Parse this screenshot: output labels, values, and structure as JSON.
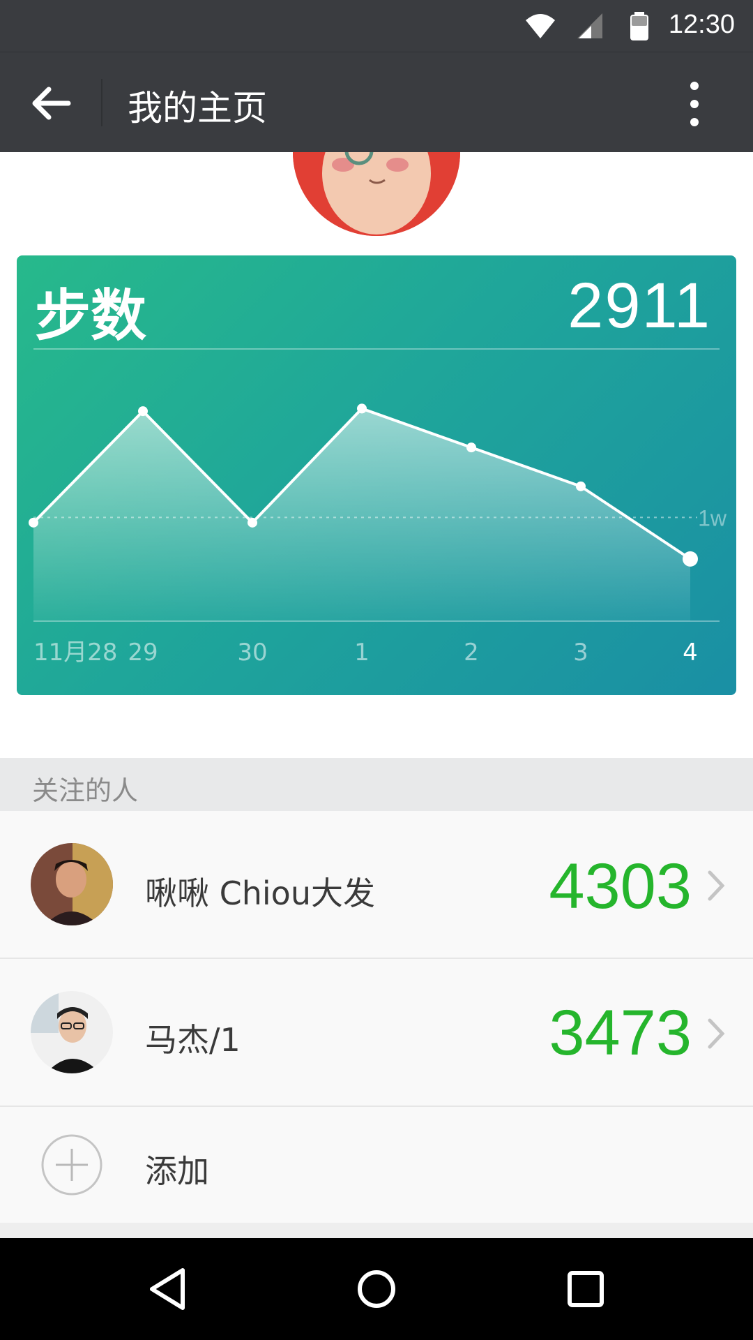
{
  "status_bar": {
    "time": "12:30",
    "icons": [
      "wifi-icon",
      "cell-signal-icon",
      "battery-icon"
    ]
  },
  "app_bar": {
    "title": "我的主页",
    "back_icon": "arrow-left-icon",
    "menu_icon": "more-vertical-icon"
  },
  "steps_card": {
    "label": "步数",
    "value": "2911",
    "colors": {
      "gradient_start": "#27b98b",
      "gradient_end": "#1a8fa4"
    }
  },
  "chart_data": {
    "type": "area",
    "categories": [
      "11月28",
      "29",
      "30",
      "1",
      "2",
      "3",
      "4"
    ],
    "values": [
      7800,
      12100,
      7800,
      12200,
      10700,
      9200,
      6400
    ],
    "ylim": [
      4000,
      14500
    ],
    "reference_line": {
      "value": 8000,
      "label": "1w"
    },
    "grid": false,
    "highlight_last": true
  },
  "following": {
    "section_title": "关注的人",
    "people": [
      {
        "name": "啾啾 Chiou大发",
        "steps": "4303",
        "avatar": "avatar-photo"
      },
      {
        "name": "马杰/1",
        "steps": "3473",
        "avatar": "avatar-photo"
      }
    ],
    "add_label": "添加",
    "steps_color": "#25b52c"
  },
  "nav_bar": {
    "icons": [
      "back-triangle-icon",
      "home-circle-icon",
      "recents-square-icon"
    ]
  }
}
